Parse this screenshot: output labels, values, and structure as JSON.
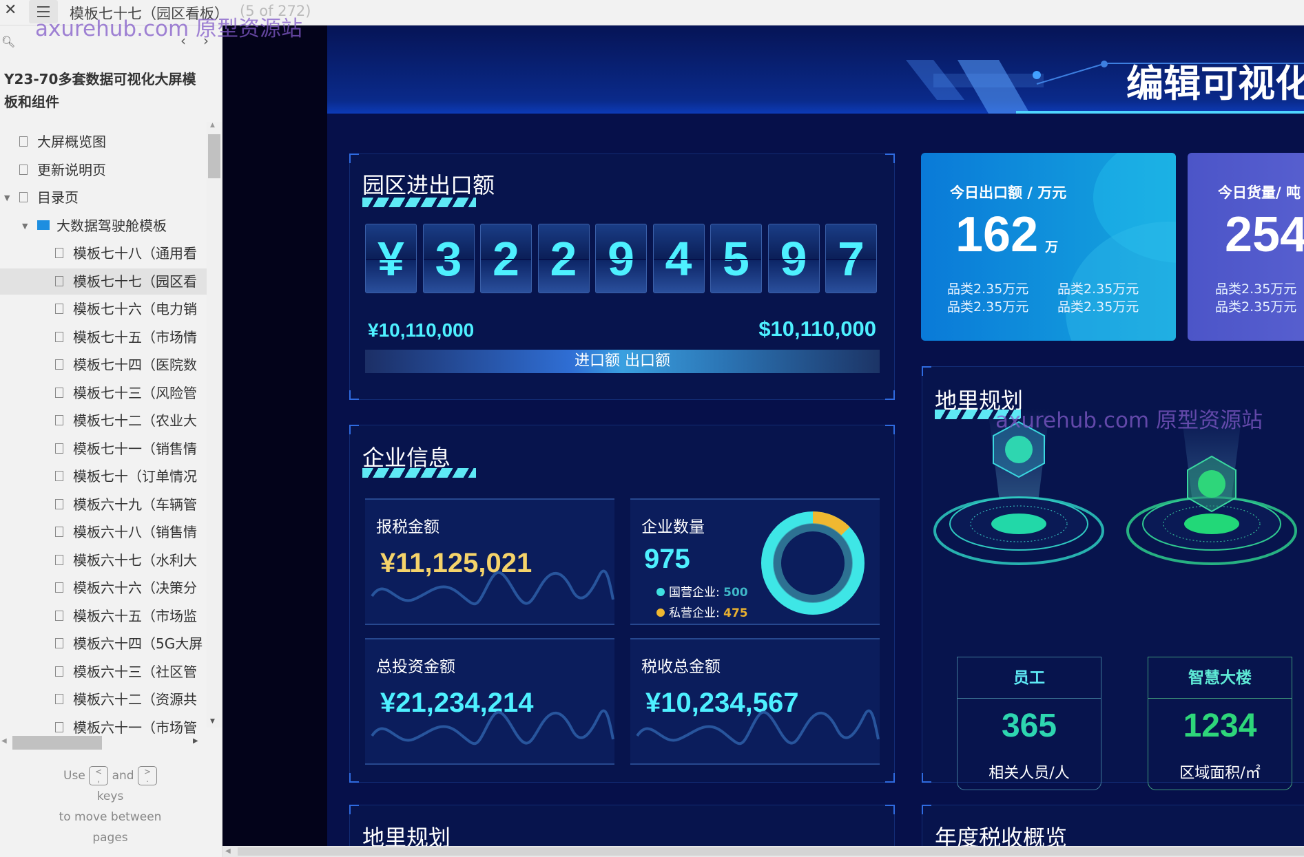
{
  "topbar": {
    "close": "✕",
    "page_title": "模板七十七（园区看板）",
    "page_count": "(5 of 272)"
  },
  "watermark": "axurehub.com 原型资源站",
  "sidebar": {
    "project_title": "Y23-70多套数据可视化大屏模板和组件",
    "items": [
      {
        "label": "大屏概览图",
        "level": 1,
        "type": "page"
      },
      {
        "label": "更新说明页",
        "level": 1,
        "type": "page"
      },
      {
        "label": "目录页",
        "level": 1,
        "type": "page",
        "expanded": true
      },
      {
        "label": "大数据驾驶舱模板",
        "level": 2,
        "type": "folder",
        "expanded": true
      },
      {
        "label": "模板七十八（通用看",
        "level": 3,
        "type": "page"
      },
      {
        "label": "模板七十七（园区看",
        "level": 3,
        "type": "page",
        "selected": true
      },
      {
        "label": "模板七十六（电力销",
        "level": 3,
        "type": "page"
      },
      {
        "label": "模板七十五（市场情",
        "level": 3,
        "type": "page"
      },
      {
        "label": "模板七十四（医院数",
        "level": 3,
        "type": "page"
      },
      {
        "label": "模板七十三（风险管",
        "level": 3,
        "type": "page"
      },
      {
        "label": "模板七十二（农业大",
        "level": 3,
        "type": "page"
      },
      {
        "label": "模板七十一（销售情",
        "level": 3,
        "type": "page"
      },
      {
        "label": "模板七十（订单情况",
        "level": 3,
        "type": "page"
      },
      {
        "label": "模板六十九（车辆管",
        "level": 3,
        "type": "page"
      },
      {
        "label": "模板六十八（销售情",
        "level": 3,
        "type": "page"
      },
      {
        "label": "模板六十七（水利大",
        "level": 3,
        "type": "page"
      },
      {
        "label": "模板六十六（决策分",
        "level": 3,
        "type": "page"
      },
      {
        "label": "模板六十五（市场监",
        "level": 3,
        "type": "page"
      },
      {
        "label": "模板六十四（5G大屏",
        "level": 3,
        "type": "page"
      },
      {
        "label": "模板六十三（社区管",
        "level": 3,
        "type": "page"
      },
      {
        "label": "模板六十二（资源共",
        "level": 3,
        "type": "page"
      },
      {
        "label": "模板六十一（市场管",
        "level": 3,
        "type": "page"
      }
    ],
    "help": {
      "use": "Use",
      "prev_key": "<\n,",
      "and": "and",
      "next_key": ">\n.",
      "keys": "keys",
      "move": "to move between",
      "pages": "pages"
    }
  },
  "dashboard": {
    "title": "编辑可视化",
    "trade": {
      "title": "园区进出口额",
      "digits": [
        "¥",
        "3",
        "2",
        "2",
        "9",
        "4",
        "5",
        "9",
        "7"
      ],
      "import_value": "¥10,110,000",
      "export_value": "$10,110,000",
      "import_label": "进口额",
      "export_label": "出口额"
    },
    "enterprise": {
      "title": "企业信息",
      "tax": {
        "label": "报税金额",
        "value": "¥11,125,021"
      },
      "count": {
        "label": "企业数量",
        "value": "975",
        "legend": [
          {
            "label": "国营企业:",
            "value": "500",
            "color": "#3fe0e0"
          },
          {
            "label": "私营企业:",
            "value": "475",
            "color": "#f0b830"
          }
        ]
      },
      "invest": {
        "label": "总投资金额",
        "value": "¥21,234,214"
      },
      "taxtotal": {
        "label": "税收总金额",
        "value": "¥10,234,567"
      }
    },
    "card1": {
      "label": "今日出口额 / 万元",
      "value": "162",
      "unit": "万",
      "items": [
        "品类2.35万元",
        "品类2.35万元",
        "品类2.35万元",
        "品类2.35万元"
      ]
    },
    "card2": {
      "label": "今日货量/ 吨",
      "value": "254",
      "items": [
        "品类2.35万元",
        "品类2.35万元"
      ]
    },
    "geo": {
      "title": "地里规划",
      "staff": {
        "header": "员工",
        "value": "365",
        "desc": "相关人员/人",
        "color": "#2ed6b0"
      },
      "building": {
        "header": "智慧大楼",
        "value": "1234",
        "desc": "区域面积/㎡",
        "color": "#2ed67a"
      }
    },
    "bottom_left_title": "地里规划",
    "bottom_right_title": "年度税收概览"
  }
}
